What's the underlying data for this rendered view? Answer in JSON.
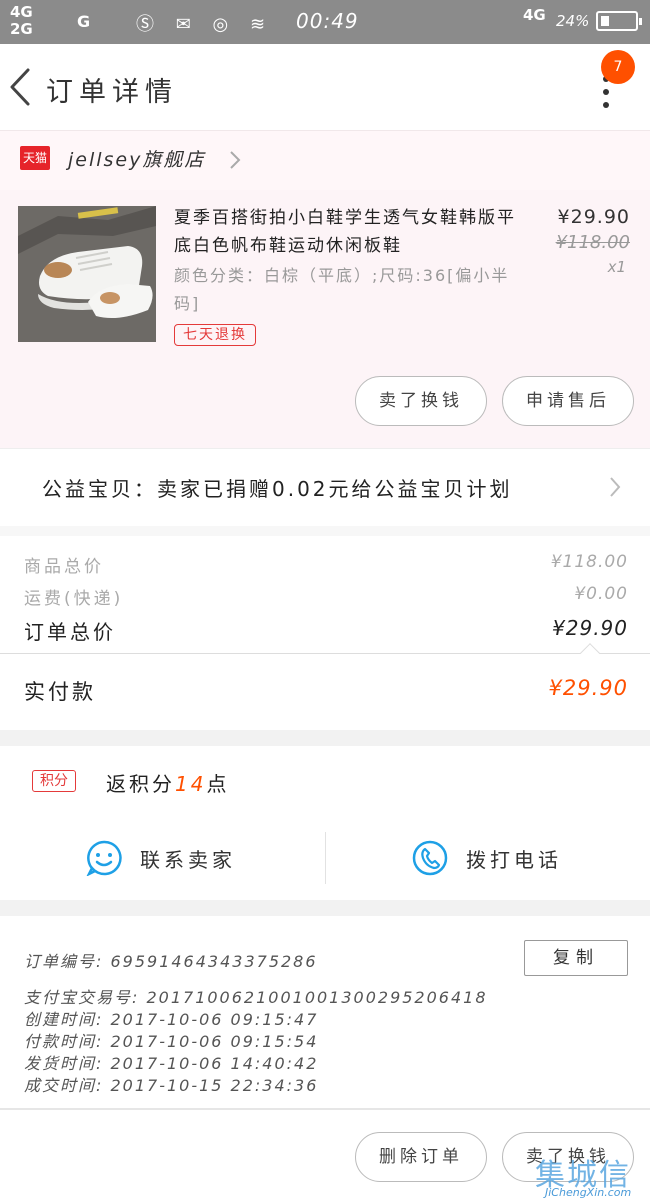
{
  "status_bar": {
    "signal_1": "4G",
    "signal_2": "2G",
    "signal_3": "G",
    "icons": "Ⓢ ✉ ◎ ≋",
    "time": "00:49",
    "network": "4G",
    "battery": "24%"
  },
  "nav": {
    "title": "订单详情",
    "badge_count": "7"
  },
  "shop": {
    "tmall_label": "天猫",
    "name": "jellsey旗舰店"
  },
  "item": {
    "name": "夏季百搭街拍小白鞋学生透气女鞋韩版平底白色帆布鞋运动休闲板鞋",
    "sku": "颜色分类：白棕（平底）;尺码:36[偏小半码]",
    "tag": "七天退换",
    "price": "¥29.90",
    "original_price": "¥118.00",
    "quantity": "x1",
    "buttons": [
      "卖了换钱",
      "申请售后"
    ]
  },
  "charity": {
    "text": "公益宝贝：卖家已捐赠0.02元给公益宝贝计划"
  },
  "summary": {
    "goods_total_label": "商品总价",
    "goods_total_value": "¥118.00",
    "shipping_label": "运费(快递)",
    "shipping_value": "¥0.00",
    "order_total_label": "订单总价",
    "order_total_value": "¥29.90",
    "paid_label": "实付款",
    "paid_value": "¥29.90"
  },
  "points": {
    "badge": "积分",
    "prefix": "返积分",
    "amount": "14",
    "suffix": "点"
  },
  "contact": {
    "seller_label": "联系卖家",
    "call_label": "拨打电话"
  },
  "order_info": {
    "order_no": "订单编号:  69591464343375286",
    "alipay_no": "支付宝交易号:  2017100621001001300295206418",
    "created": "创建时间:  2017-10-06 09:15:47",
    "paid": "付款时间:  2017-10-06 09:15:54",
    "shipped": "发货时间:  2017-10-06 14:40:42",
    "completed": "成交时间:  2017-10-15 22:34:36",
    "copy_label": "复制"
  },
  "footer": {
    "buttons": [
      "删除订单",
      "卖了换钱"
    ]
  },
  "watermark": {
    "big": "集城信",
    "small": "JiChengXin.com"
  },
  "colors": {
    "accent": "#ff5000",
    "tmall_red": "#e6242a",
    "tag_red": "#e43a3a",
    "contact_blue": "#1ea0e6"
  }
}
